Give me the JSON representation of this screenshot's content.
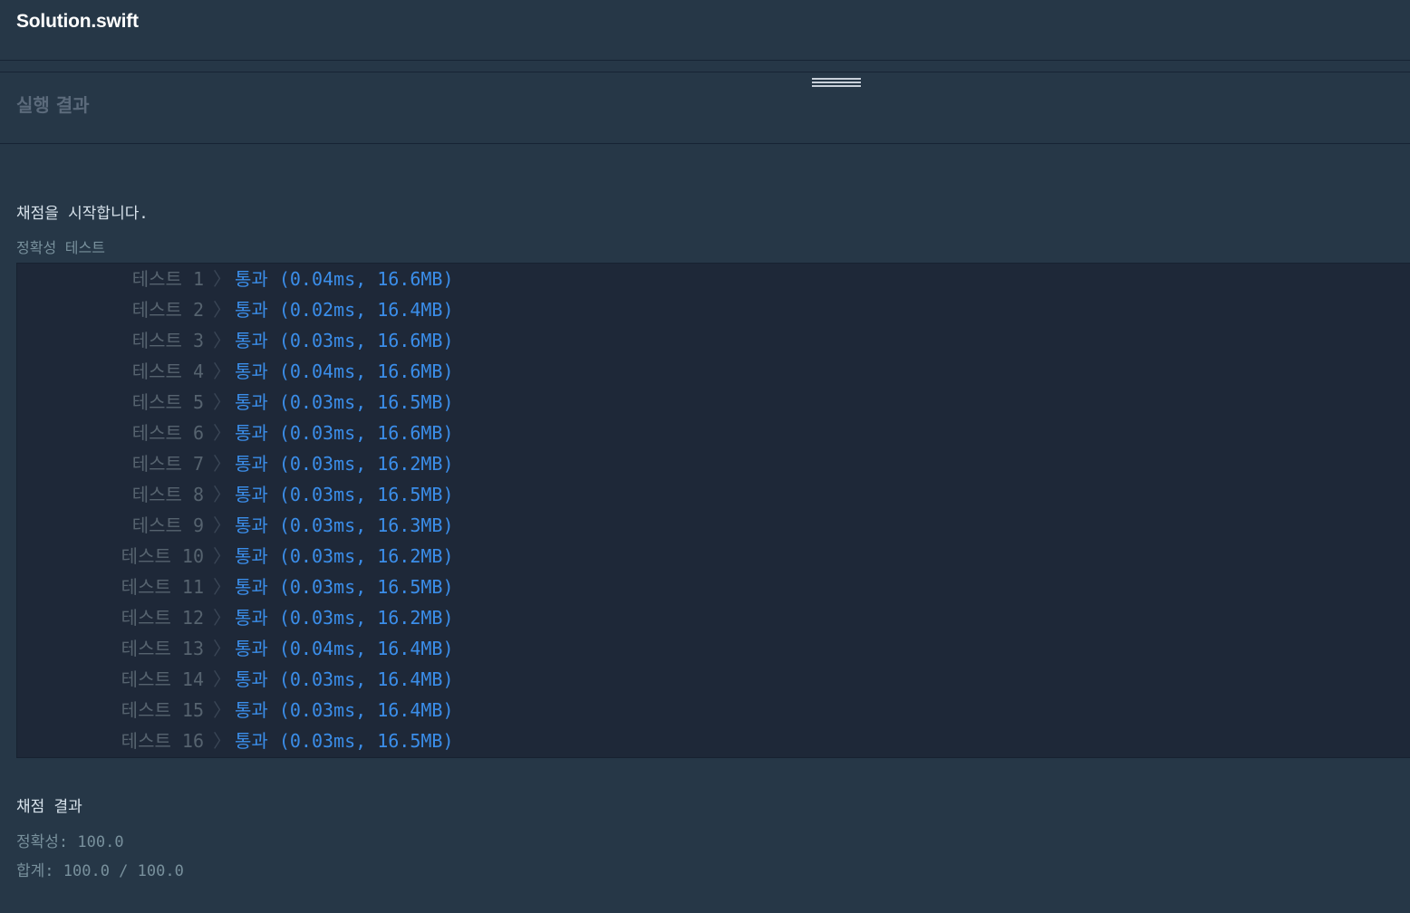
{
  "editor": {
    "file_name": "Solution.swift"
  },
  "result_panel": {
    "title": "실행 결과"
  },
  "console": {
    "start_message": "채점을 시작합니다.",
    "test_group_label": "정확성  테스트",
    "tests": [
      {
        "label": "테스트 1",
        "status": "통과 (0.04ms, 16.6MB)"
      },
      {
        "label": "테스트 2",
        "status": "통과 (0.02ms, 16.4MB)"
      },
      {
        "label": "테스트 3",
        "status": "통과 (0.03ms, 16.6MB)"
      },
      {
        "label": "테스트 4",
        "status": "통과 (0.04ms, 16.6MB)"
      },
      {
        "label": "테스트 5",
        "status": "통과 (0.03ms, 16.5MB)"
      },
      {
        "label": "테스트 6",
        "status": "통과 (0.03ms, 16.6MB)"
      },
      {
        "label": "테스트 7",
        "status": "통과 (0.03ms, 16.2MB)"
      },
      {
        "label": "테스트 8",
        "status": "통과 (0.03ms, 16.5MB)"
      },
      {
        "label": "테스트 9",
        "status": "통과 (0.03ms, 16.3MB)"
      },
      {
        "label": "테스트 10",
        "status": "통과 (0.03ms, 16.2MB)"
      },
      {
        "label": "테스트 11",
        "status": "통과 (0.03ms, 16.5MB)"
      },
      {
        "label": "테스트 12",
        "status": "통과 (0.03ms, 16.2MB)"
      },
      {
        "label": "테스트 13",
        "status": "통과 (0.04ms, 16.4MB)"
      },
      {
        "label": "테스트 14",
        "status": "통과 (0.03ms, 16.4MB)"
      },
      {
        "label": "테스트 15",
        "status": "통과 (0.03ms, 16.4MB)"
      },
      {
        "label": "테스트 16",
        "status": "통과 (0.03ms, 16.5MB)"
      }
    ],
    "test_arrow_glyph": "〉",
    "summary": {
      "title": "채점 결과",
      "accuracy": "정확성: 100.0",
      "total": "합계: 100.0 / 100.0"
    }
  },
  "colors": {
    "background": "#263747",
    "pass": "#3b8eea",
    "muted": "#78909c"
  }
}
